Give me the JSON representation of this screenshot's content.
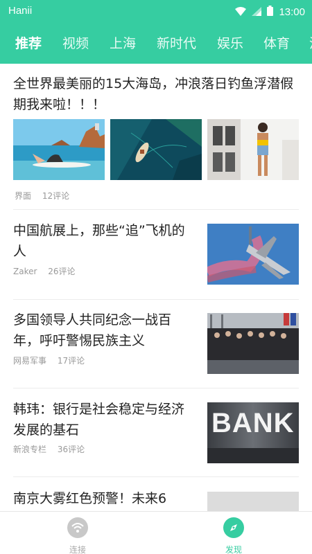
{
  "status_bar": {
    "carrier": "Hanii",
    "time": "13:00"
  },
  "tabs": [
    "推荐",
    "视频",
    "上海",
    "新时代",
    "娱乐",
    "体育",
    "消"
  ],
  "articles": [
    {
      "title": "全世界最美丽的15大海岛，冲浪落日钓鱼浮潜假期我来啦！！！",
      "source": "界面",
      "comments": "12评论"
    },
    {
      "title": "中国航展上，那些“追”飞机的人",
      "source": "Zaker",
      "comments": "26评论"
    },
    {
      "title": "多国领导人共同纪念一战百年，呼吁警惕民族主义",
      "source": "网易军事",
      "comments": "17评论"
    },
    {
      "title": "韩玮：银行是社会稳定与经济发展的基石",
      "source": "新浪专栏",
      "comments": "36评论"
    },
    {
      "title": "南京大雾红色预警！未来6"
    }
  ],
  "images": {
    "bank_sign": "BANK"
  },
  "bottom_nav": [
    {
      "label": "连接",
      "icon": "wifi-icon"
    },
    {
      "label": "发现",
      "icon": "compass-icon"
    }
  ],
  "colors": {
    "accent": "#36cda1",
    "nav_inactive": "#aaaaaa",
    "meta_text": "#999999"
  }
}
